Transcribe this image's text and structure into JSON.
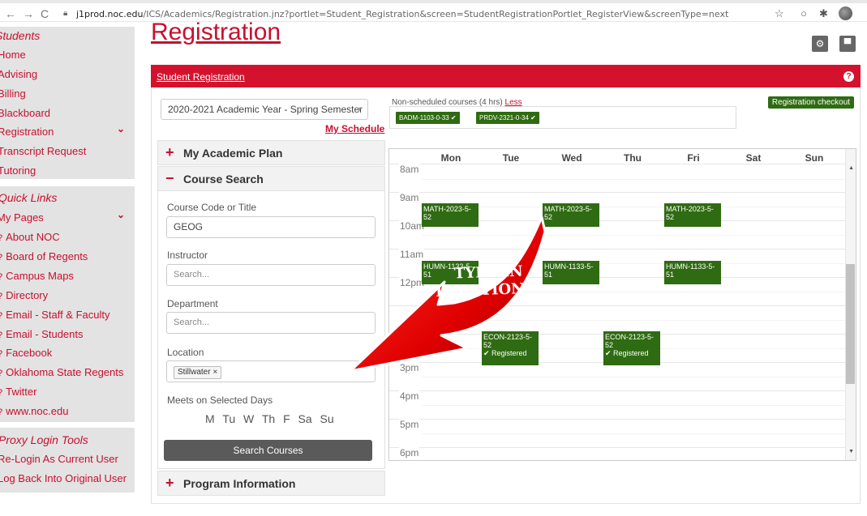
{
  "browser": {
    "url_host": "j1prod.noc.edu",
    "url_path": "/ICS/Academics/Registration.jnz?portlet=Student_Registration&screen=StudentRegistrationPortlet_RegisterView&screenType=next"
  },
  "sidebar": {
    "section1_heading": "Students",
    "section1_items": [
      "Home",
      "Advising",
      "Billing",
      "Blackboard",
      "Registration",
      "Transcript Request",
      "Tutoring"
    ],
    "section2_heading": "Quick Links",
    "my_pages": "My Pages",
    "links": [
      "About NOC",
      "Board of Regents",
      "Campus Maps",
      "Directory",
      "Email - Staff & Faculty",
      "Email - Students",
      "Facebook",
      "Oklahoma State Regents",
      "Twitter",
      "www.noc.edu"
    ],
    "section3_heading": "Proxy Login Tools",
    "proxy_items": [
      "Re-Login As Current User",
      "Log Back Into Original User"
    ]
  },
  "page": {
    "heading": "Registration",
    "portlet_title": "Student Registration"
  },
  "left": {
    "term": "2020-2021 Academic Year - Spring Semester",
    "my_schedule": "My Schedule",
    "academic_plan": "My Academic Plan",
    "course_search": "Course Search",
    "program_info": "Program Information",
    "code_label": "Course Code or Title",
    "code_value": "GEOG",
    "instructor_label": "Instructor",
    "instructor_placeholder": "Search...",
    "department_label": "Department",
    "department_placeholder": "Search...",
    "location_label": "Location",
    "location_tag": "Stillwater ×",
    "days_label": "Meets on Selected Days",
    "days": "M Tu W Th F Sa Su",
    "search_button": "Search Courses"
  },
  "right": {
    "nonsched_label": "Non-scheduled courses (4 hrs)",
    "less": "Less",
    "chips": [
      "BADM-1103-0-33 ✔",
      "PRDV-2321-0-34 ✔"
    ],
    "checkout": "Registration checkout"
  },
  "calendar": {
    "days": [
      "Mon",
      "Tue",
      "Wed",
      "Thu",
      "Fri",
      "Sat",
      "Sun"
    ],
    "hours": [
      "8am",
      "9am",
      "10am",
      "11am",
      "12pm",
      "1pm",
      "2pm",
      "3pm",
      "4pm",
      "5pm",
      "6pm"
    ],
    "events": [
      {
        "code": "MATH-2023-5-",
        "sec": "52",
        "status": ""
      },
      {
        "code": "MATH-2023-5-",
        "sec": "52",
        "status": ""
      },
      {
        "code": "MATH-2023-5-",
        "sec": "52",
        "status": ""
      },
      {
        "code": "HUMN-1133-5-",
        "sec": "51",
        "status": ""
      },
      {
        "code": "HUMN-1133-5-",
        "sec": "51",
        "status": ""
      },
      {
        "code": "HUMN-1133-5-",
        "sec": "51",
        "status": ""
      },
      {
        "code": "ECON-2123-5-",
        "sec": "52",
        "status": "✔ Registered"
      },
      {
        "code": "ECON-2123-5-",
        "sec": "52",
        "status": "✔ Registered"
      }
    ]
  },
  "annotation": {
    "line1": "TYPE IN",
    "line2": "LOCATION"
  },
  "colors": {
    "brand_red": "#d4122e",
    "link_red": "#c8102e",
    "event_green": "#2f6b12"
  }
}
